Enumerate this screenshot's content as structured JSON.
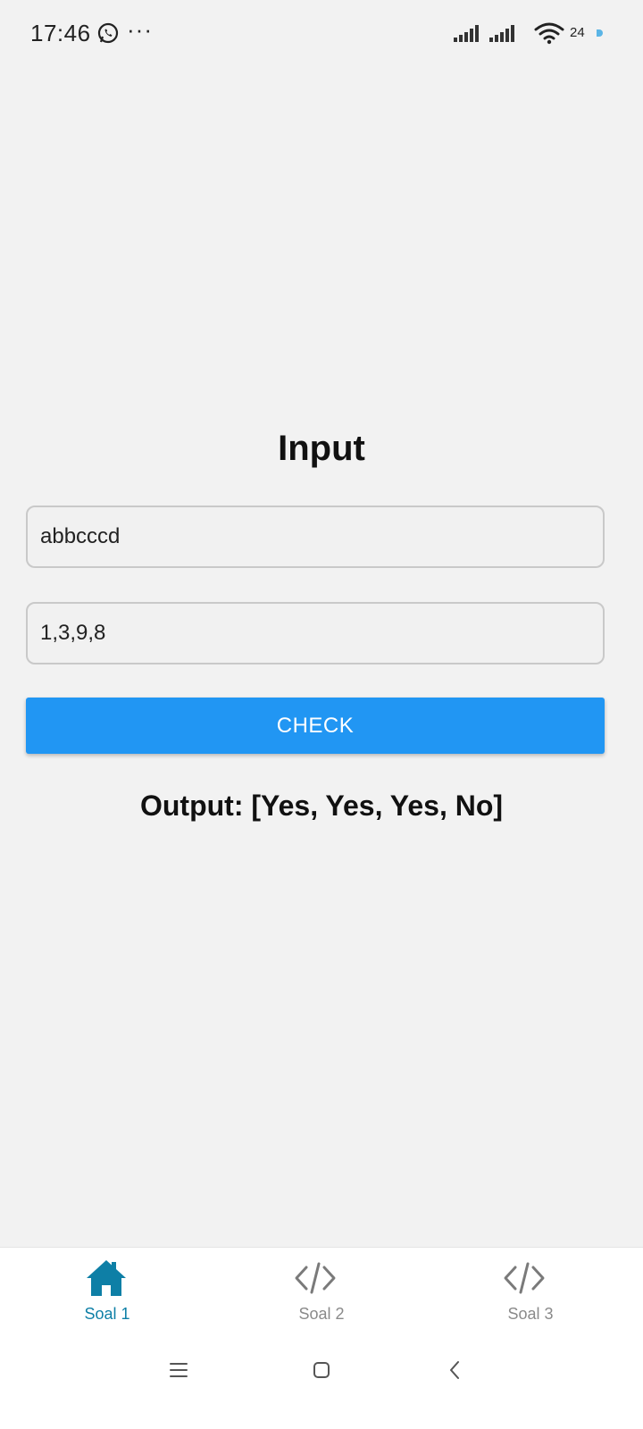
{
  "status_bar": {
    "time": "17:46",
    "dots": "···",
    "battery": "24"
  },
  "main": {
    "title": "Input",
    "input_string": "abbcccd",
    "input_queries": "1,3,9,8",
    "check_label": "CHECK",
    "output": "Output: [Yes, Yes, Yes, No]"
  },
  "bottom_nav": {
    "items": [
      {
        "label": "Soal 1",
        "icon": "home-icon",
        "active": true
      },
      {
        "label": "Soal 2",
        "icon": "code-icon",
        "active": false
      },
      {
        "label": "Soal 3",
        "icon": "code-icon",
        "active": false
      }
    ],
    "active_color": "#0e7fa6",
    "inactive_color": "#8a8a8a"
  },
  "colors": {
    "button": "#2196f3",
    "background": "#f2f2f2"
  }
}
